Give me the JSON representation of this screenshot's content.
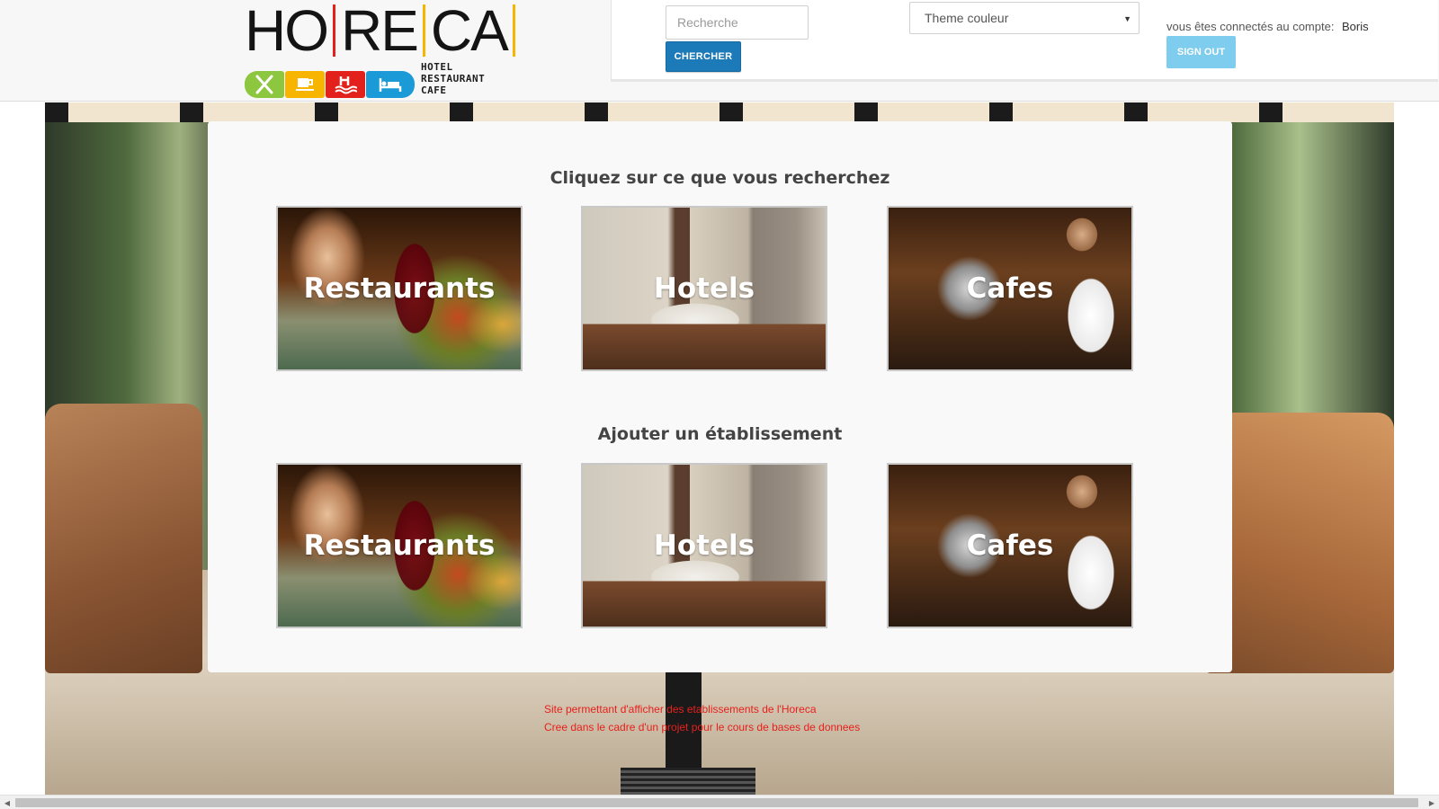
{
  "header": {
    "logo_word": [
      "HO",
      "RE",
      "CA"
    ],
    "logo_tagline": [
      "HOTEL",
      "RESTAURANT",
      "CAFE"
    ],
    "logo_icons": [
      "cutlery-icon",
      "coffee-cup-icon",
      "pool-icon",
      "bed-icon"
    ],
    "logo_colors": [
      "#8dc63f",
      "#f7b500",
      "#e2211c",
      "#1a9bd7"
    ],
    "search": {
      "placeholder": "Recherche",
      "value": "",
      "button_label": "CHERCHER"
    },
    "theme_select": {
      "selected": "Theme couleur"
    },
    "account": {
      "label": "vous êtes connectés au compte:",
      "username": "Boris",
      "signout_label": "SIGN OUT"
    }
  },
  "main": {
    "search_section_title": "Cliquez sur ce que vous recherchez",
    "search_tiles": [
      {
        "label": "Restaurants"
      },
      {
        "label": "Hotels"
      },
      {
        "label": "Cafes"
      }
    ],
    "add_section_title": "Ajouter un établissement",
    "add_tiles": [
      {
        "label": "Restaurants"
      },
      {
        "label": "Hotels"
      },
      {
        "label": "Cafes"
      }
    ]
  },
  "footer": {
    "line1": "Site permettant d'afficher des etablissements de l'Horeca",
    "line2": "Cree dans le cadre d'un projet pour le cours de bases de donnees"
  },
  "colors": {
    "primary_button": "#1d7ab8",
    "signout_button": "#7fcdee",
    "footer_text": "#e8201c"
  }
}
